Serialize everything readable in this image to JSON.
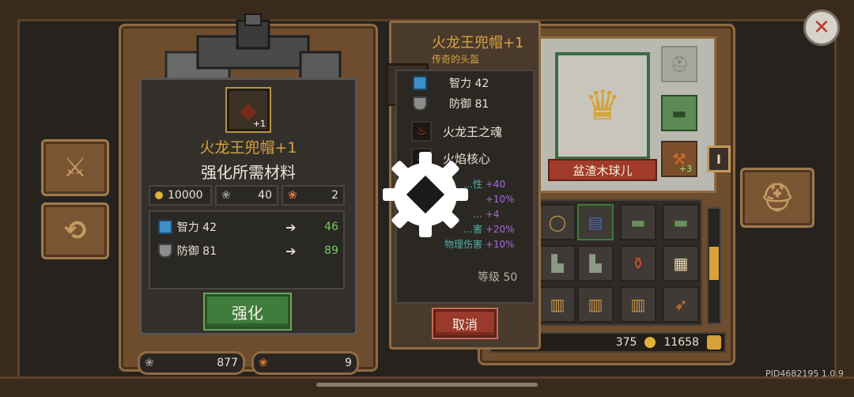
{
  "upgrade_panel": {
    "item_name": "火龙王兜帽+1",
    "item_level_badge": "+1",
    "title": "强化所需材料",
    "gold_cost": "10000",
    "material1_cost": "40",
    "material2_cost": "2",
    "stats": [
      {
        "icon": "intelligence-icon",
        "label": "智力 42",
        "new_value": "46"
      },
      {
        "icon": "defense-icon",
        "label": "防御 81",
        "new_value": "89"
      }
    ],
    "upgrade_button": "强化"
  },
  "bottom_counters": {
    "material1_count": "877",
    "material2_count": "9"
  },
  "tooltip": {
    "item_name": "火龙王兜帽+1",
    "rarity": "传奇的头盔",
    "stats": [
      {
        "icon": "intelligence-icon",
        "label": "智力 42"
      },
      {
        "icon": "defense-icon",
        "label": "防御 81"
      }
    ],
    "gems": [
      {
        "icon": "fire-soul-icon",
        "label": "火龙王之魂"
      },
      {
        "icon": "flame-core-icon",
        "label": "火焰核心"
      }
    ],
    "bonus_values": [
      "+40",
      "+10%",
      "+4",
      "+20%",
      "+10%"
    ],
    "bonus_labels": [
      "…性",
      "",
      "…",
      "…害",
      "物理伤害"
    ],
    "level_label": "等级 50",
    "cancel_button": "取消"
  },
  "character": {
    "name": "盆渣木球儿",
    "weapon_badge": "+3"
  },
  "inventory": {
    "gem_count": "375",
    "gold_count": "11658"
  },
  "version_text": "PID4682195 1.0.9",
  "colors": {
    "wood": "#6d4d2e",
    "gold_text": "#d8a13c",
    "green_value": "#6fcf5a",
    "purple_bonus": "#a46bd6"
  }
}
